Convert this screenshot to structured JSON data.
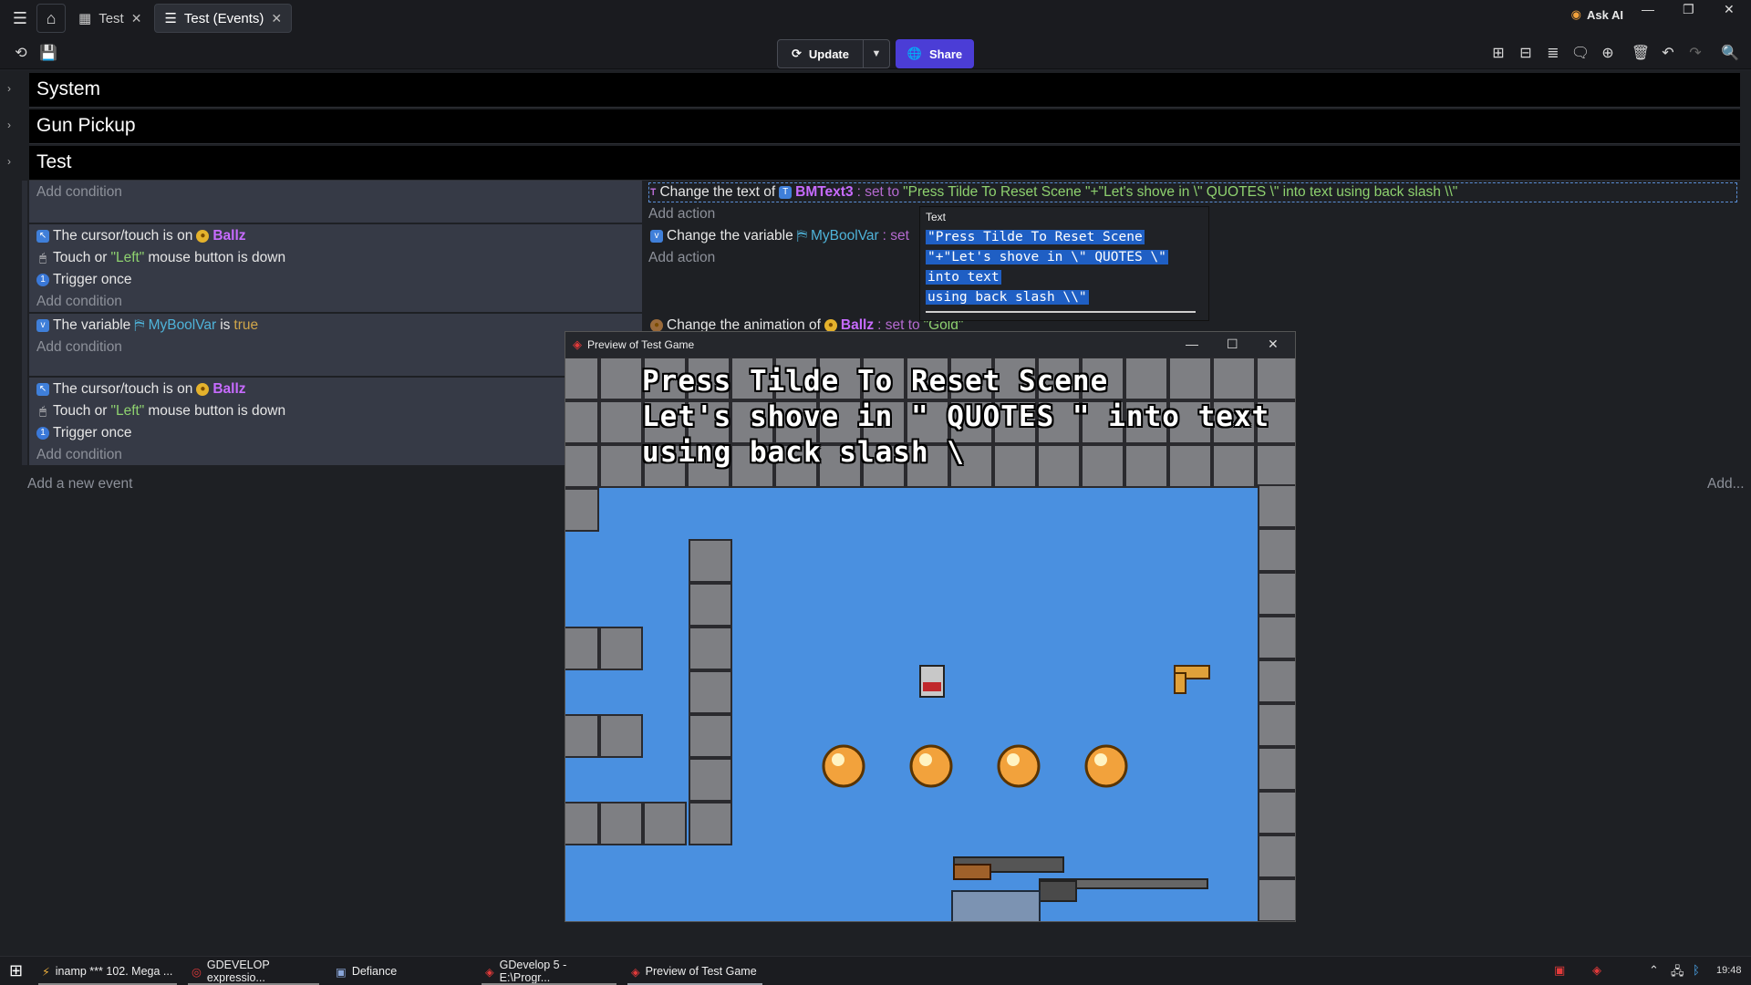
{
  "titlebar": {
    "tabs": [
      {
        "label": "Test"
      },
      {
        "label": "Test (Events)"
      }
    ],
    "ask_ai": "Ask AI"
  },
  "toolbar": {
    "update_label": "Update",
    "share_label": "Share"
  },
  "groups": [
    "System",
    "Gun Pickup",
    "Test"
  ],
  "events": {
    "add_condition": "Add condition",
    "add_action": "Add action",
    "e1_action": {
      "prefix": "Change the text of",
      "object": "BMText3",
      "set_to": ": set to",
      "value": "\"Press Tilde To Reset Scene \"+\"Let's shove in \\\" QUOTES \\\" into text using back slash \\\\\""
    },
    "e2": {
      "c1_prefix": "The cursor/touch is on",
      "c1_object": "Ballz",
      "c2_prefix": "Touch or",
      "c2_button": "\"Left\"",
      "c2_suffix": "mouse button is down",
      "c3": "Trigger once",
      "a1_prefix": "Change the variable",
      "a1_var": "MyBoolVar",
      "a1_set": ": set"
    },
    "e3": {
      "c1_prefix": "The variable",
      "c1_var": "MyBoolVar",
      "c1_is": "is",
      "c1_val": "true",
      "a1_prefix": "Change the animation of",
      "a1_object": "Ballz",
      "a1_set": ": set to",
      "a1_val": "\"Gold\""
    },
    "e4": {
      "c1_prefix": "The cursor/touch is on",
      "c1_object": "Ballz",
      "c2_prefix": "Touch or",
      "c2_button": "\"Left\"",
      "c2_suffix": "mouse button is down",
      "c3": "Trigger once"
    },
    "add_new_event": "Add a new event",
    "add_right": "Add..."
  },
  "tooltip": {
    "title": "Text",
    "lines": [
      "\"Press Tilde To Reset Scene ",
      "\"+\"Let's shove in \\\" QUOTES \\\"",
      "into text ",
      "using back slash \\\\\""
    ]
  },
  "preview": {
    "title": "Preview of Test Game",
    "game_text": [
      "Press Tilde To Reset Scene",
      "Let's shove in \" QUOTES \" into text",
      "using back slash \\"
    ]
  },
  "taskbar": {
    "items": [
      "inamp *** 102. Mega ...",
      "GDEVELOP expressio...",
      "Defiance",
      "GDevelop 5 - E:\\Progr...",
      "Preview of Test Game"
    ],
    "time": "19:48"
  },
  "colors": {
    "accent": "#4b3dd6",
    "object": "#c76bff",
    "string": "#8ed16f",
    "variable": "#4fb3d9",
    "game_bg": "#4a90e0"
  }
}
